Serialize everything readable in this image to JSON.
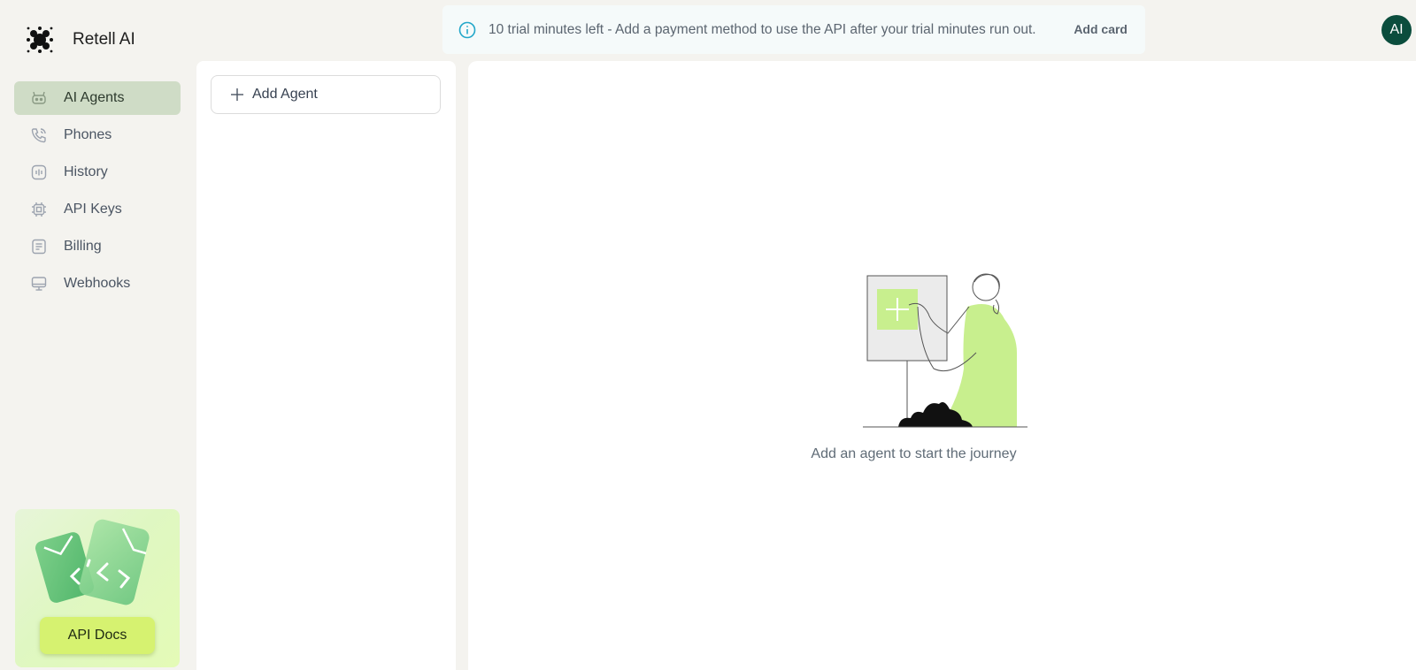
{
  "app": {
    "name": "Retell AI"
  },
  "sidebar": {
    "items": [
      {
        "label": "AI Agents",
        "icon": "robot-icon",
        "active": true
      },
      {
        "label": "Phones",
        "icon": "phone-icon",
        "active": false
      },
      {
        "label": "History",
        "icon": "history-icon",
        "active": false
      },
      {
        "label": "API Keys",
        "icon": "chip-icon",
        "active": false
      },
      {
        "label": "Billing",
        "icon": "receipt-icon",
        "active": false
      },
      {
        "label": "Webhooks",
        "icon": "monitor-icon",
        "active": false
      }
    ],
    "promo": {
      "button_label": "API Docs"
    }
  },
  "banner": {
    "icon": "info-icon",
    "message": "10 trial minutes left - Add a payment method to use the API after your trial minutes run out.",
    "action_label": "Add card"
  },
  "user": {
    "initials": "AI"
  },
  "agents": {
    "add_label": "Add Agent"
  },
  "main": {
    "empty_text": "Add an agent to start the journey"
  },
  "colors": {
    "accent": "#d6f270",
    "active_nav": "#cfdcc6",
    "avatar": "#0b4d3d",
    "background": "#f4f3ef"
  }
}
